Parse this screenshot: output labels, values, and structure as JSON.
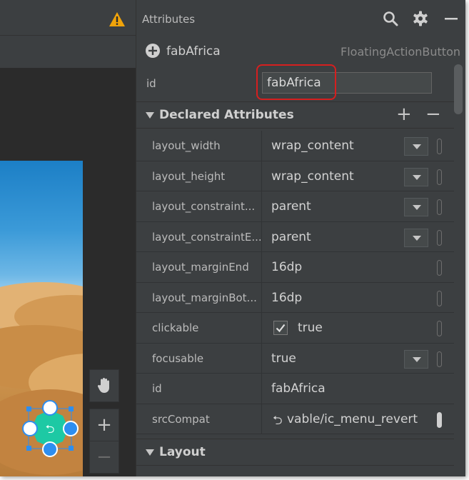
{
  "attributes_panel": {
    "title": "Attributes",
    "icons": [
      "search-icon",
      "gear-icon",
      "minimize-icon"
    ]
  },
  "component": {
    "name": "fabAfrica",
    "class_name": "FloatingActionButton"
  },
  "id_field": {
    "label": "id",
    "value": "fabAfrica"
  },
  "declared_section": {
    "title": "Declared Attributes",
    "add_label": "+",
    "remove_label": "−"
  },
  "declared_attributes": [
    {
      "name": "layout_width",
      "value": "wrap_content",
      "control": "dropdown"
    },
    {
      "name": "layout_height",
      "value": "wrap_content",
      "control": "dropdown"
    },
    {
      "name": "layout_constraint...",
      "value": "parent",
      "control": "dropdown"
    },
    {
      "name": "layout_constraintE...",
      "value": "parent",
      "control": "dropdown"
    },
    {
      "name": "layout_marginEnd",
      "value": "16dp",
      "control": "text"
    },
    {
      "name": "layout_marginBot...",
      "value": "16dp",
      "control": "text"
    },
    {
      "name": "clickable",
      "value": "true",
      "control": "checkbox",
      "checked": true
    },
    {
      "name": "focusable",
      "value": "true",
      "control": "dropdown"
    },
    {
      "name": "id",
      "value": "fabAfrica",
      "control": "text"
    },
    {
      "name": "srcCompat",
      "value": "vable/ic_menu_revert",
      "control": "resource"
    }
  ],
  "layout_section": {
    "title": "Layout"
  },
  "design_surface": {
    "zoom_in_label": "+",
    "zoom_out_label": "−",
    "warning_icon": "warning-icon",
    "pan_icon": "hand-icon"
  },
  "colors": {
    "panel_bg": "#3c3f41",
    "editor_bg": "#2b2b2b",
    "highlight_border": "#d61f1f",
    "fab_color": "#1dc9a4",
    "selection_handle": "#2d8ef0",
    "warning": "#f0a30a"
  }
}
